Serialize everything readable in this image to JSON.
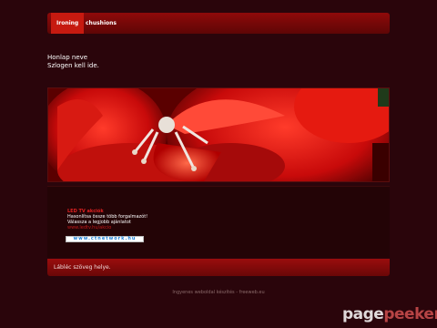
{
  "nav": {
    "items": [
      {
        "label": "Ironing",
        "active": true
      },
      {
        "label": "chushions",
        "active": false
      }
    ]
  },
  "site": {
    "name": "Honlap neve",
    "slogan": "Szlogen kell ide."
  },
  "ad": {
    "title": "LED TV akciók",
    "line1": "Hasonlítsa össze több forgalmazót!",
    "line2": "Válassza a legjobb ajánlatot",
    "url": "www.ledtv.hu/akcio",
    "banner": "www.ctnetwork.hu"
  },
  "footer": {
    "text": "Lábléc szöveg helye."
  },
  "credit": "Ingyenes weboldal készítés - freeweb.eu",
  "watermark": {
    "a": "page",
    "b": "peeker"
  },
  "colors": {
    "background": "#2a050b",
    "accent": "#c61a10",
    "panel": "#230406"
  }
}
